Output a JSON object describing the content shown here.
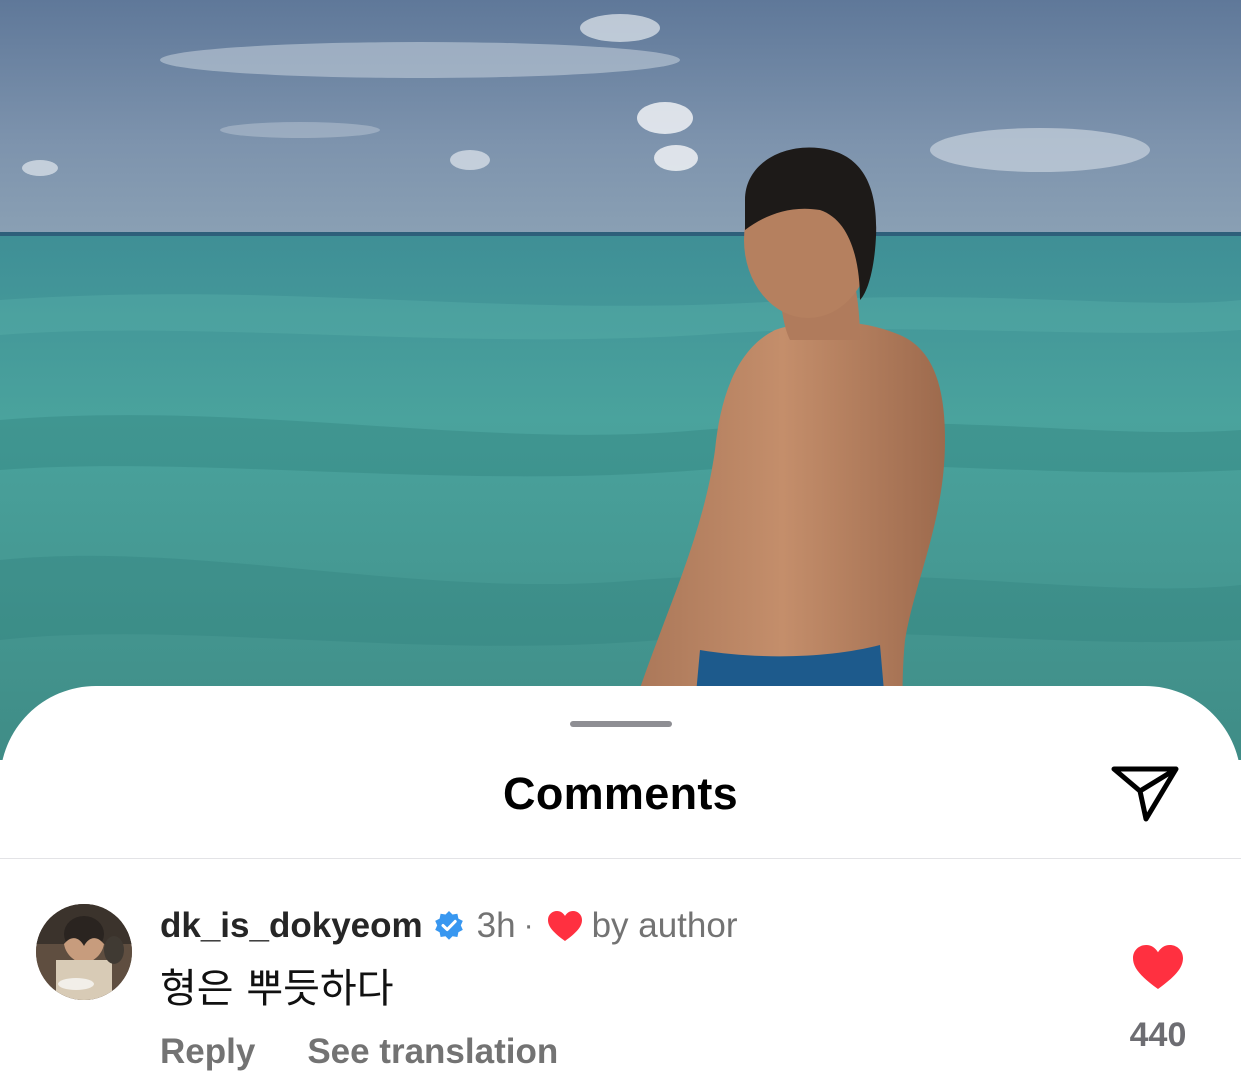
{
  "sheet": {
    "title": "Comments",
    "share_icon": "paper-plane-icon"
  },
  "comment": {
    "username": "dk_is_dokyeom",
    "verified_icon": "verified-badge-icon",
    "time": "3h",
    "separator": "·",
    "creator_heart_icon": "heart-icon",
    "liked_by_label": "by author",
    "text": "형은 뿌듯하다",
    "reply_label": "Reply",
    "translate_label": "See translation",
    "like_icon": "heart-icon",
    "like_count": "440"
  },
  "colors": {
    "heart_red": "#ff3040",
    "verified_blue": "#3897f0",
    "muted_text": "#737373"
  }
}
